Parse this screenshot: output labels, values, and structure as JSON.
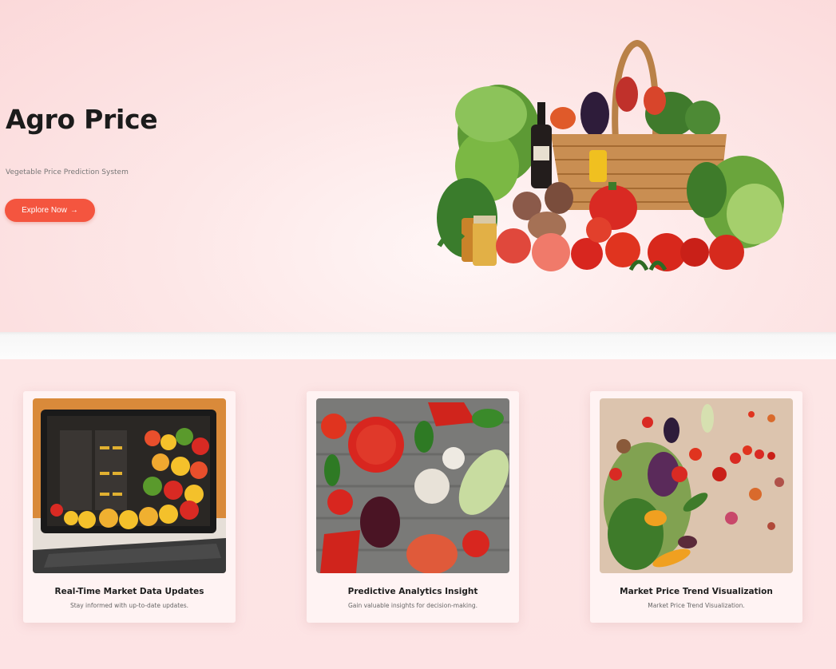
{
  "hero": {
    "title": "Agro Price",
    "subtitle": "Vegetable Price Prediction System",
    "cta_label": "Explore Now",
    "cta_arrow": "→",
    "accent_color": "#f4553f"
  },
  "features": {
    "cards": [
      {
        "title": "Real-Time Market Data Updates",
        "description": "Stay informed with up-to-date updates.",
        "image": "laptop-with-vegetables-image"
      },
      {
        "title": "Predictive Analytics Insight",
        "description": "Gain valuable insights for decision-making.",
        "image": "vegetables-on-wood-image"
      },
      {
        "title": "Market Price Trend Visualization",
        "description": "Market Price Trend Visualization.",
        "image": "scattered-vegetables-image"
      }
    ]
  }
}
